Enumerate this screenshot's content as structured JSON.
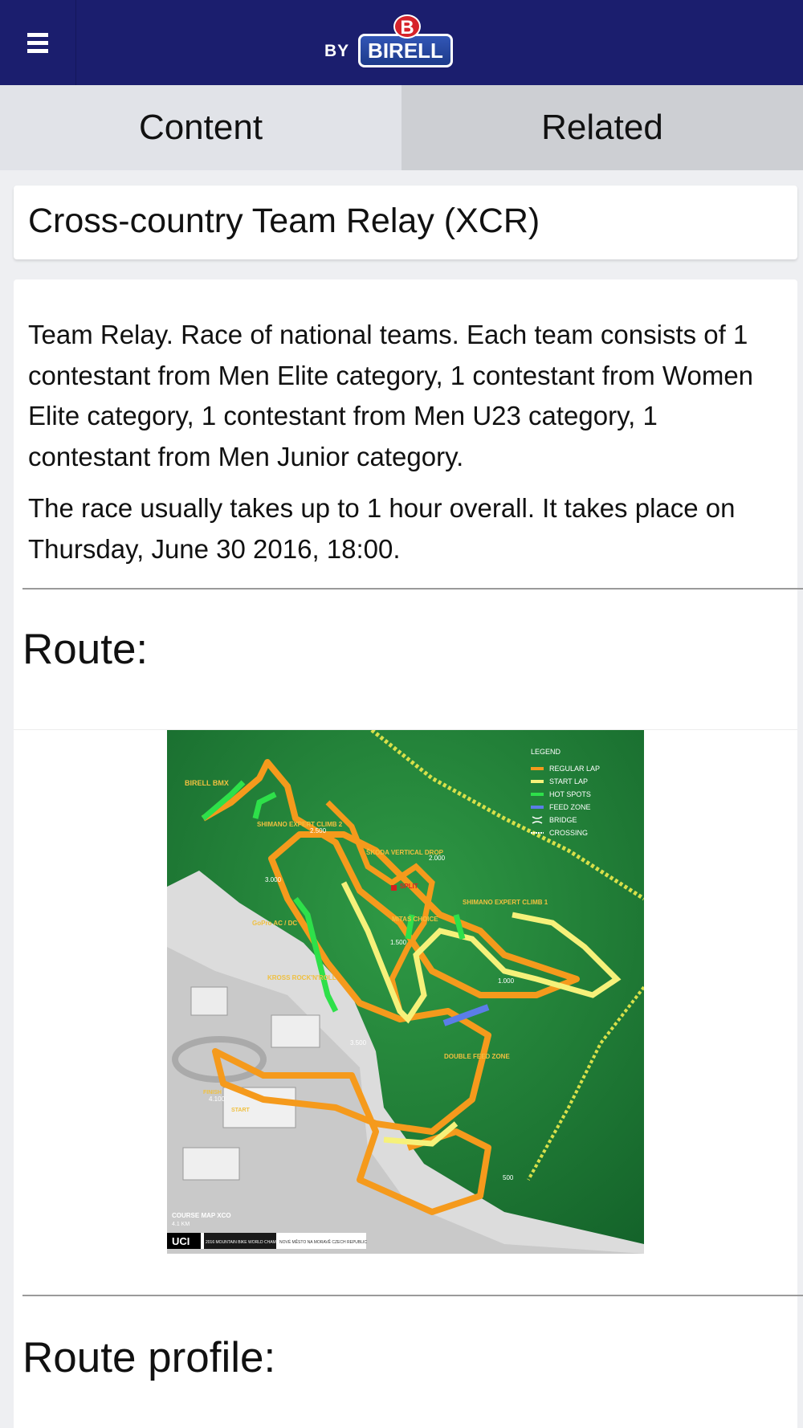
{
  "header": {
    "menu_icon": "hamburger-menu-icon",
    "logo_by": "BY",
    "logo_text": "BIRELL",
    "logo_mark": "B"
  },
  "tabs": [
    {
      "label": "Content",
      "active": true
    },
    {
      "label": "Related",
      "active": false
    }
  ],
  "title": "Cross-country Team Relay (XCR)",
  "body": {
    "paragraph_1": "Team Relay. Race of national teams. Each team consists of 1 contestant from Men Elite category, 1 contestant from Women Elite category, 1 contestant from Men U23 category, 1 contestant from Men Junior category.",
    "paragraph_2": "The race usually takes up to 1 hour overall. It takes place on Thursday, June 30 2016, 18:00."
  },
  "route_heading": "Route:",
  "route_profile_heading": "Route profile:",
  "map": {
    "legend_title": "LEGEND",
    "legend": [
      {
        "label": "REGULAR LAP",
        "color": "#f59a1c"
      },
      {
        "label": "START LAP",
        "color": "#f6f17a"
      },
      {
        "label": "HOT SPOTS",
        "color": "#2ee04a"
      },
      {
        "label": "FEED ZONE",
        "color": "#5b7de8"
      },
      {
        "label": "BRIDGE",
        "color": "#ffffff"
      },
      {
        "label": "CROSSING",
        "color": "#ffffff"
      }
    ],
    "labels": {
      "birell_bmx": "BIRELL BMX",
      "shimano_expert_climb_2": "SHIMANO EXPERT CLIMB 2",
      "skoda_vertical_drop": "ŠKODA VERTICAL DROP",
      "split": "SPLIT",
      "mitas_choice": "MITAS CHOICE",
      "shimano_expert_climb_1": "SHIMANO EXPERT CLIMB 1",
      "gopro": "GoPro AC / DC",
      "kross": "KROSS ROCK'N'ROLL",
      "double_feed_zone": "DOUBLE FEED ZONE",
      "finish": "FINISH",
      "start": "START",
      "course_map": "COURSE MAP XCO",
      "course_length": "4.1 KM",
      "uci": "UCI",
      "event": "2016 MOUNTAIN BIKE WORLD CHAMPIONSHIPS",
      "venue": "NOVÉ MĚSTO NA MORAVĚ CZECH REPUBLIC"
    },
    "distances": [
      "2.500",
      "2.000",
      "3.000",
      "1.500",
      "1.000",
      "3.500",
      "4.100",
      "500"
    ]
  }
}
